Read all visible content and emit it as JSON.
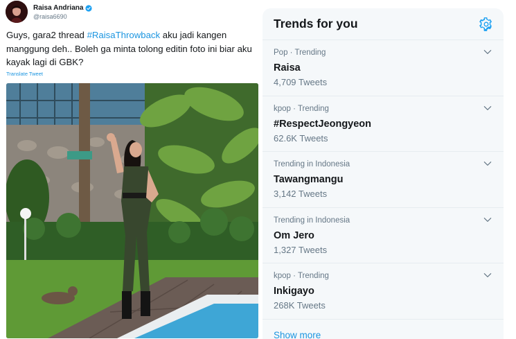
{
  "tweet": {
    "display_name": "Raisa Andriana",
    "handle": "@raisa6690",
    "text_part1": "Guys, gara2 thread ",
    "hashtag": "#RaisaThrowback",
    "text_part2": " aku jadi kangen manggung deh.. Boleh ga minta tolong editin foto ini biar aku kayak lagi di GBK?",
    "translate_label": "Translate Tweet"
  },
  "trends": {
    "title": "Trends for you",
    "items": [
      {
        "meta": "Pop · Trending",
        "name": "Raisa",
        "count": "4,709 Tweets"
      },
      {
        "meta": "kpop · Trending",
        "name": "#RespectJeongyeon",
        "count": "62.6K Tweets"
      },
      {
        "meta": "Trending in Indonesia",
        "name": "Tawangmangu",
        "count": "3,142 Tweets"
      },
      {
        "meta": "Trending in Indonesia",
        "name": "Om Jero",
        "count": "1,327 Tweets"
      },
      {
        "meta": "kpop · Trending",
        "name": "Inkigayo",
        "count": "268K Tweets"
      }
    ],
    "show_more": "Show more"
  },
  "colors": {
    "accent": "#1b95e0",
    "panel_bg": "#f5f8fa",
    "muted_text": "#657786"
  }
}
